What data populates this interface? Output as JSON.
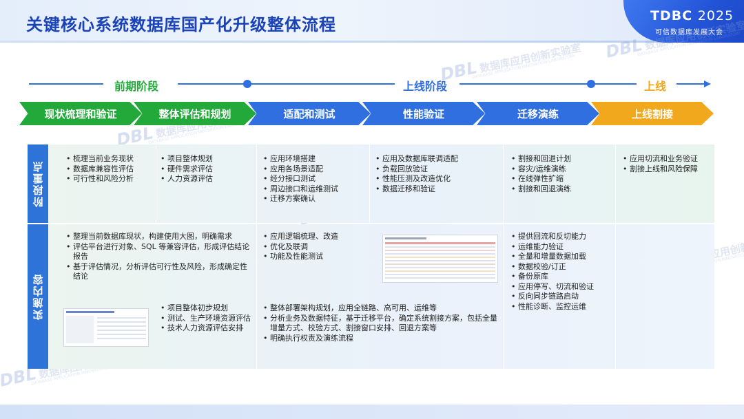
{
  "title": "关键核心系统数据库国产化升级整体流程",
  "brand": {
    "main": "TDBC",
    "year": "2025",
    "sub": "可信数据库发展大会"
  },
  "watermark": {
    "logo": "DBL",
    "text": "数据库应用创新实验室",
    "en": "DATABASE APPLICATION INNOVATION LABORATORY"
  },
  "colors": {
    "green": "#22a93a",
    "blue": "#2f6fe0",
    "orange": "#f2a81d",
    "title": "#1b43b8"
  },
  "timeline": {
    "phase1": "前期阶段",
    "phase2": "上线阶段",
    "phase3": "上线"
  },
  "stages": [
    "现状梳理和验证",
    "整体评估和规划",
    "适配和测试",
    "性能验证",
    "迁移演练",
    "上线割接"
  ],
  "rows": {
    "focus_label": "阶段重点",
    "impl_label": "实施内容"
  },
  "focus": [
    [
      "梳理当前业务现状",
      "数据库兼容性评估",
      "可行性和风险分析"
    ],
    [
      "项目整体规划",
      "硬件需求评估",
      "人力资源评估"
    ],
    [
      "应用环境搭建",
      "应用各场景适配",
      "经分接口测试",
      "周边接口和运维测试",
      "迁移方案确认"
    ],
    [
      "应用及数据库联调适配",
      "负载回放验证",
      "性能压测及改造优化",
      "数据迁移和验证"
    ],
    [
      "割接和回退计划",
      "容灾/运维演练",
      "在线弹性扩缩",
      "割接和回退演练"
    ],
    [
      "应用切流和业务验证",
      "割接上线和风险保障"
    ]
  ],
  "impl": {
    "s1_top": [
      "整理当前数据库现状，构建使用大图，明确需求",
      "评估平台进行对象、SQL 等兼容评估，形成评估结论报告",
      "基于评估情况，分析评估可行性及风险，形成确定性结论"
    ],
    "s2_bottom": [
      "项目整体初步规划",
      "测试、生产环境资源评估",
      "技术人力资源评估安排"
    ],
    "s3_top": [
      "应用逻辑梳理、改造",
      "优化及联调",
      "功能及性能测试"
    ],
    "s34_bottom": [
      "整体部署架构规划，应用全链路、高可用、运维等",
      "分析业务及数据特征，基于迁移平台，确定系统割接方案，包括全量增量方式、校验方式、割接窗口安排、回退方案等",
      "明确执行权责及演练流程"
    ],
    "s5": [
      "提供回流和反切能力",
      "运维能力验证",
      "全量和增量数据加载",
      "数据校验/订正",
      "备份原库",
      "应用停写、切流和验证",
      "反向同步链路启动",
      "性能诊断、监控运维"
    ]
  }
}
